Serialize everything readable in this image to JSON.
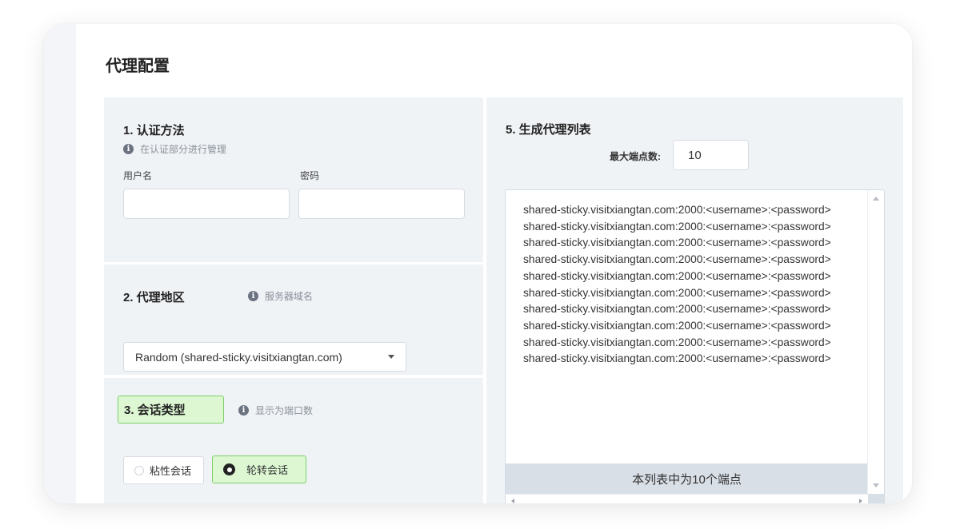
{
  "page": {
    "title": "代理配置"
  },
  "auth": {
    "title": "1. 认证方法",
    "hint": "在认证部分进行管理",
    "username_label": "用户名",
    "password_label": "密码",
    "username_value": "",
    "password_value": ""
  },
  "region": {
    "title": "2. 代理地区",
    "hint": "服务器域名",
    "selected": "Random (shared-sticky.visitxiangtan.com)"
  },
  "session": {
    "title": "3. 会话类型",
    "hint": "显示为端口数",
    "options": [
      {
        "label": "粘性会话",
        "selected": false
      },
      {
        "label": "轮转会话",
        "selected": true
      }
    ]
  },
  "list": {
    "title": "5. 生成代理列表",
    "max_label": "最大端点数:",
    "max_value": "10",
    "lines": [
      "shared-sticky.visitxiangtan.com:2000:<username>:<password>",
      "shared-sticky.visitxiangtan.com:2000:<username>:<password>",
      "shared-sticky.visitxiangtan.com:2000:<username>:<password>",
      "shared-sticky.visitxiangtan.com:2000:<username>:<password>",
      "shared-sticky.visitxiangtan.com:2000:<username>:<password>",
      "shared-sticky.visitxiangtan.com:2000:<username>:<password>",
      "shared-sticky.visitxiangtan.com:2000:<username>:<password>",
      "shared-sticky.visitxiangtan.com:2000:<username>:<password>",
      "shared-sticky.visitxiangtan.com:2000:<username>:<password>",
      "shared-sticky.visitxiangtan.com:2000:<username>:<password>"
    ],
    "count_text": "本列表中为10个端点"
  },
  "icons": {
    "info": "info-icon",
    "dropdown": "chevron-down-icon",
    "radio_on": "radio-selected-icon",
    "radio_off": "radio-empty-icon"
  },
  "colors": {
    "panel_bg": "#f0f3f6",
    "highlight_bg": "#dcf7d2",
    "highlight_border": "#7ecf6a",
    "count_bar_bg": "#d9dfe7"
  }
}
